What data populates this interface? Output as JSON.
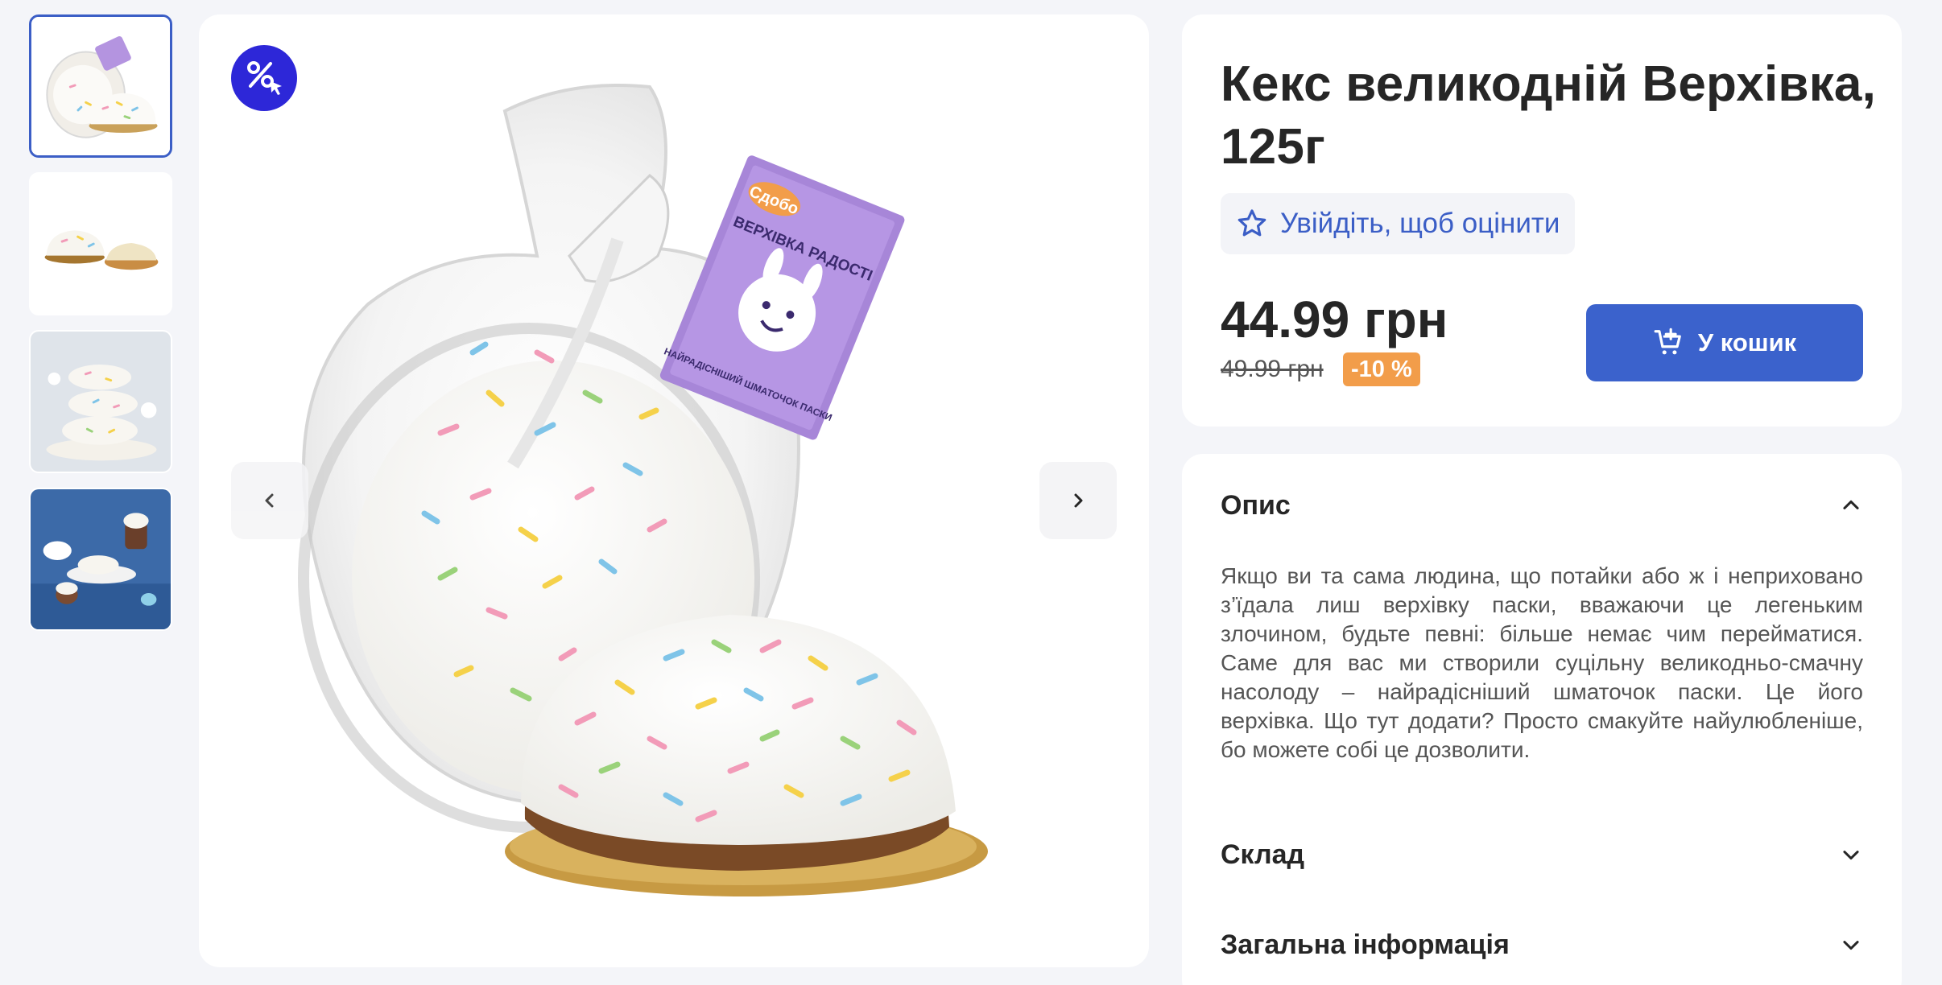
{
  "product": {
    "title": "Кекс великодній Верхівка, 125г",
    "rate_label": "Увійдіть, щоб оцінити",
    "price": "44.99 грн",
    "old_price": "49.99 грн",
    "discount": "-10 %",
    "cart_label": "У кошик"
  },
  "sections": {
    "description_title": "Опис",
    "description_text": "Якщо ви та сама людина, що потайки або ж і неприховано з’їдала лиш верхівку паски, вважаючи це легеньким злочином, будьте певні: більше немає чим перейматися. Саме для вас ми створили суцільну великодньо-смачну насолоду – найрадісніший шматочок паски. Це його верхівка. Що тут додати? Просто смакуйте найулюбленіше, бо можете собі це дозволити.",
    "composition_title": "Склад",
    "general_title": "Загальна інформація"
  },
  "package_label": {
    "brand": "Сдобо",
    "line1": "ВЕРХІВКА РАДОСТІ",
    "line2": "НАЙРАДІСНІШИЙ ШМАТОЧОК ПАСКИ"
  },
  "icons": {
    "promo": "percent-cursor-icon",
    "star": "star-outline-icon",
    "cart": "cart-plus-icon",
    "prev": "chevron-left-icon",
    "next": "chevron-right-icon",
    "collapse": "chevron-up-icon",
    "expand": "chevron-down-icon"
  },
  "colors": {
    "accent": "#3b62cc",
    "promo_badge": "#2d27d8",
    "discount": "#f29d4a",
    "link": "#3b5ec6"
  }
}
